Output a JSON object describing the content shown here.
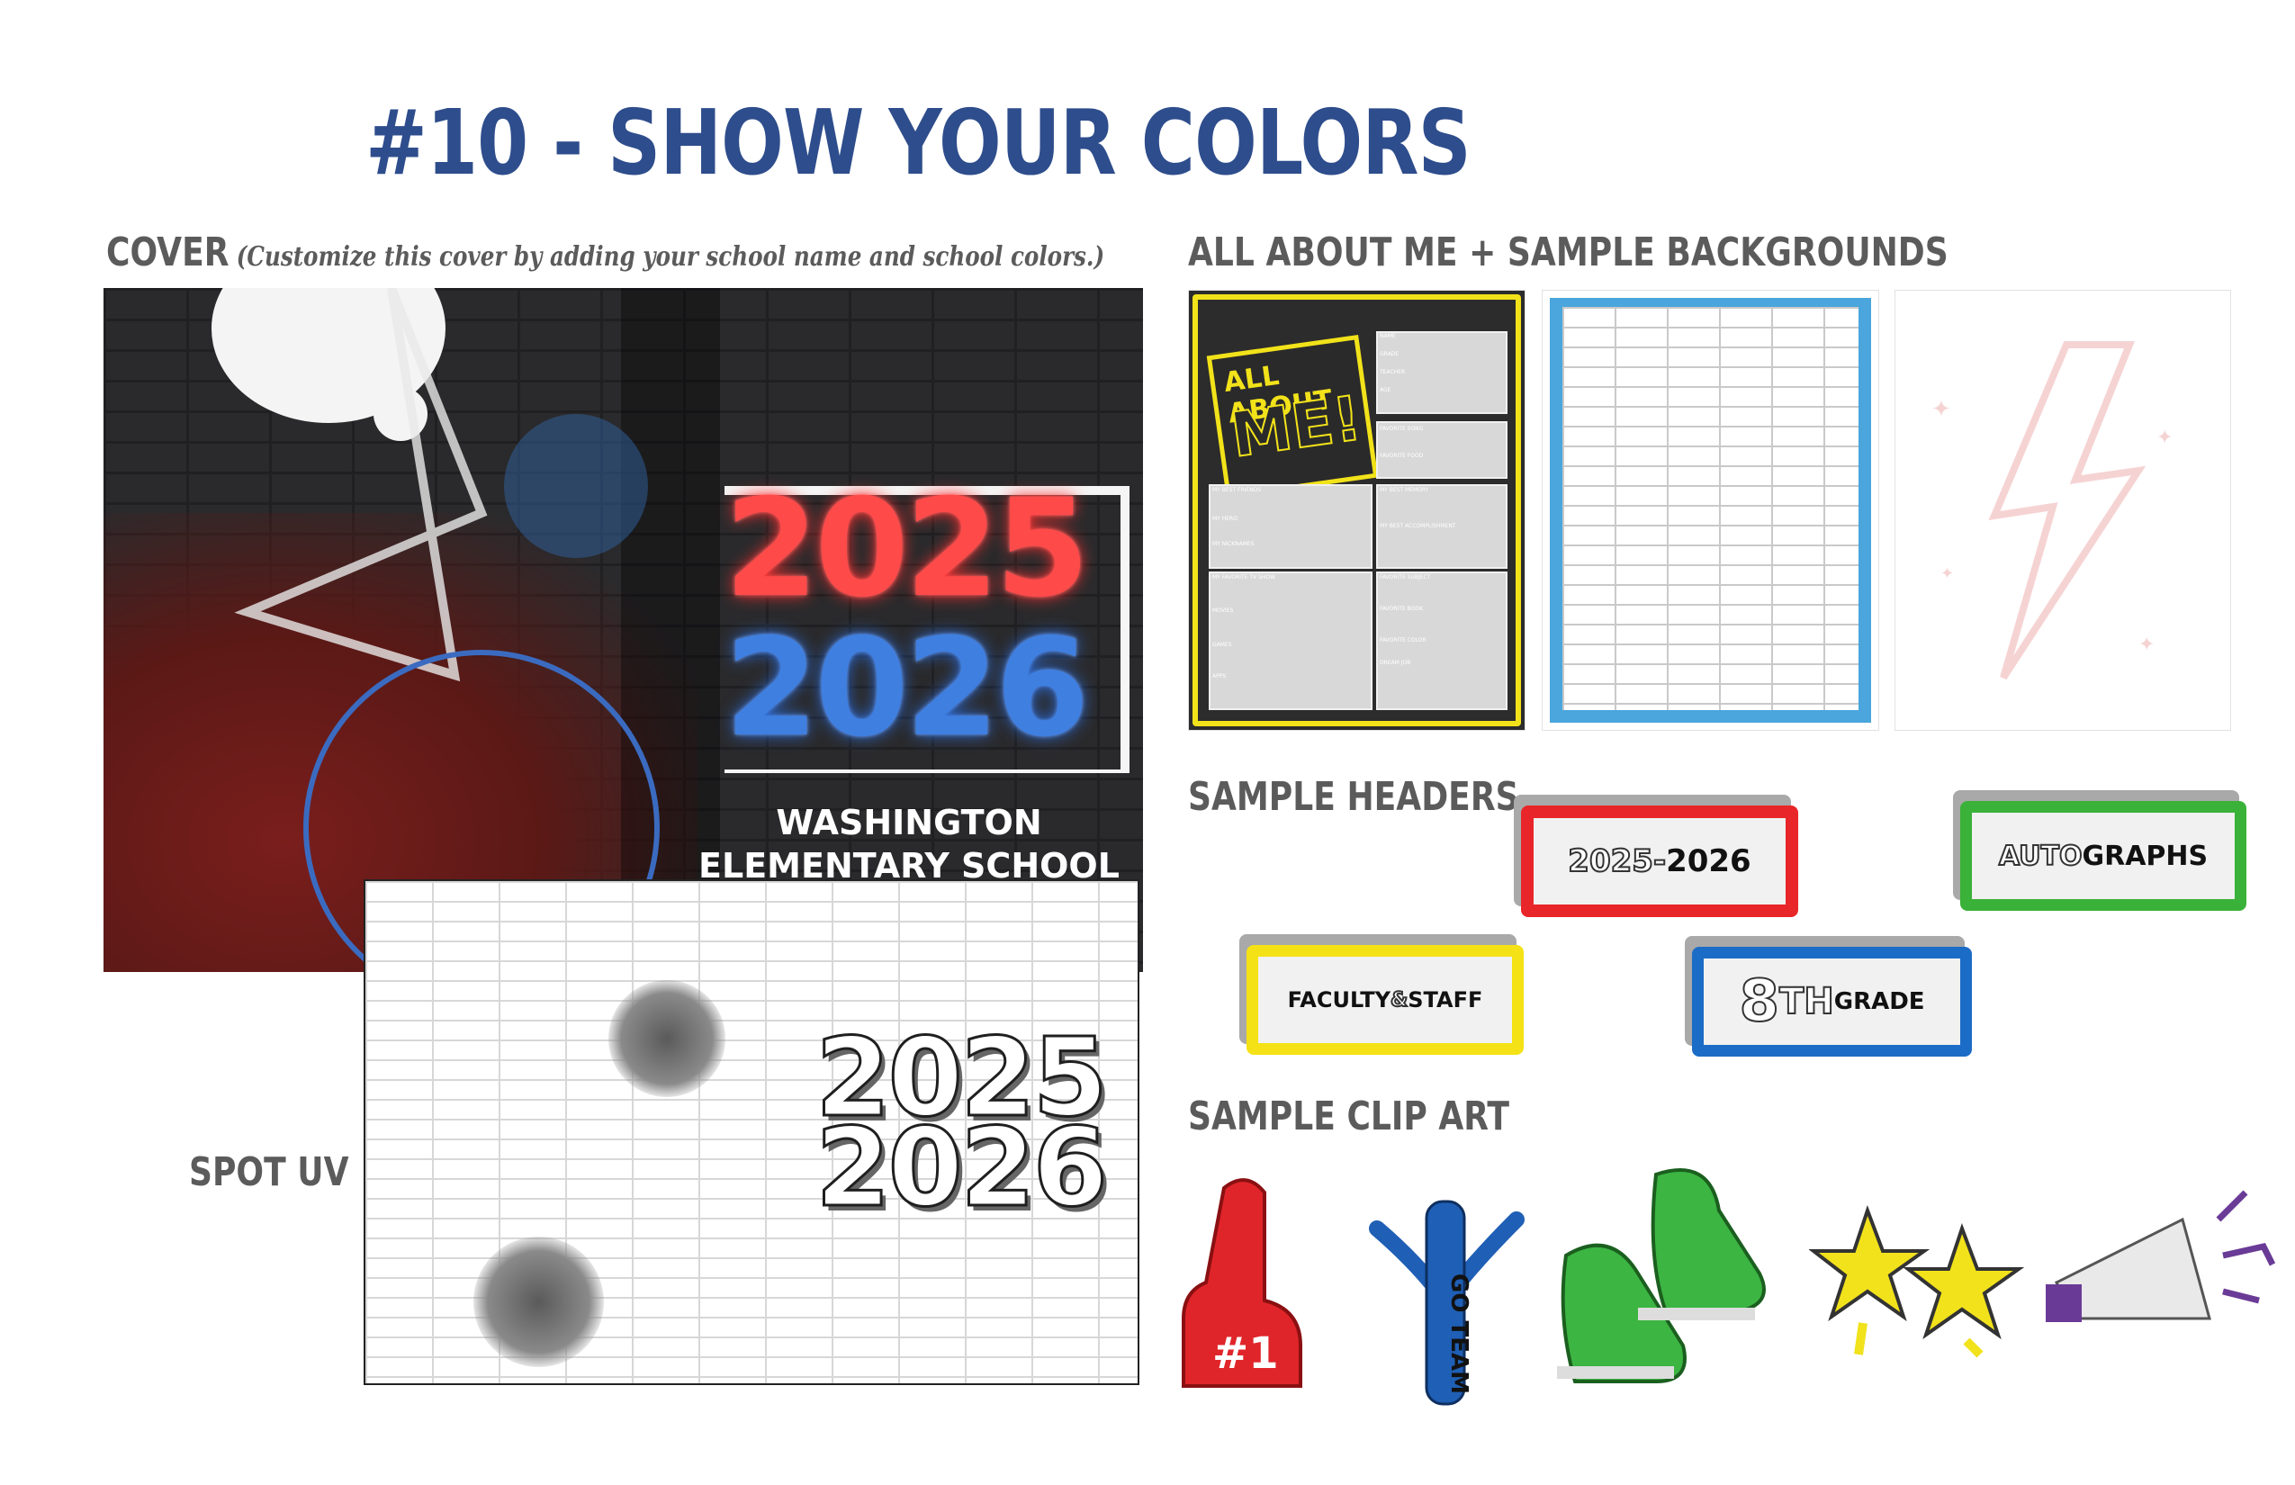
{
  "title": "#10 - SHOW YOUR COLORS",
  "cover": {
    "label": "COVER",
    "note": "(Customize this cover by adding your school name and school colors.)",
    "year_top": "2025",
    "year_bottom": "2026",
    "school_line1": "WASHINGTON",
    "school_line2": "ELEMENTARY SCHOOL"
  },
  "spot_uv": {
    "label": "SPOT UV",
    "year_top": "2025",
    "year_bottom": "2026"
  },
  "backgrounds": {
    "label": "ALL ABOUT ME + SAMPLE BACKGROUNDS",
    "aam_title_1": "ALL ABOUT",
    "aam_title_2": "ME!",
    "fields": {
      "name": "NAME",
      "grade": "GRADE",
      "teacher": "TEACHER",
      "age": "AGE",
      "favorite_song": "FAVORITE SONG",
      "favorite_food": "FAVORITE FOOD",
      "best_friends": "MY BEST FRIENDS",
      "best_memory": "MY BEST MEMORY",
      "hero": "MY HERO",
      "nicknames": "MY NICKNAMES",
      "best_accomplishment": "MY BEST ACCOMPLISHMENT",
      "favorite_tv": "MY FAVORITE TV SHOW",
      "movies": "MOVIES",
      "games": "GAMES",
      "apps": "APPS",
      "favorite_subject": "FAVORITE SUBJECT",
      "favorite_book": "FAVORITE BOOK",
      "favorite_color": "FAVORITE COLOR",
      "dream_job": "DREAM JOB"
    }
  },
  "headers": {
    "label": "SAMPLE HEADERS",
    "red_a": "2025",
    "red_sep": " - ",
    "red_b": "2026",
    "green_a": "AUTO",
    "green_b": "GRAPHS",
    "yellow_a": "FACULTY",
    "yellow_amp": "&",
    "yellow_b": "STAFF",
    "blue_a": "8",
    "blue_th": "TH",
    "blue_b": "GRADE"
  },
  "clipart": {
    "label": "SAMPLE CLIP ART",
    "foam_finger_text": "#1",
    "tube_man_text": "GO TEAM"
  },
  "colors": {
    "title_blue": "#2e4d8c",
    "label_gray": "#5b5b5b",
    "accent_red": "#e8262a",
    "accent_blue": "#1b6cc6",
    "accent_green": "#3ab138",
    "accent_yellow": "#f4e216"
  }
}
